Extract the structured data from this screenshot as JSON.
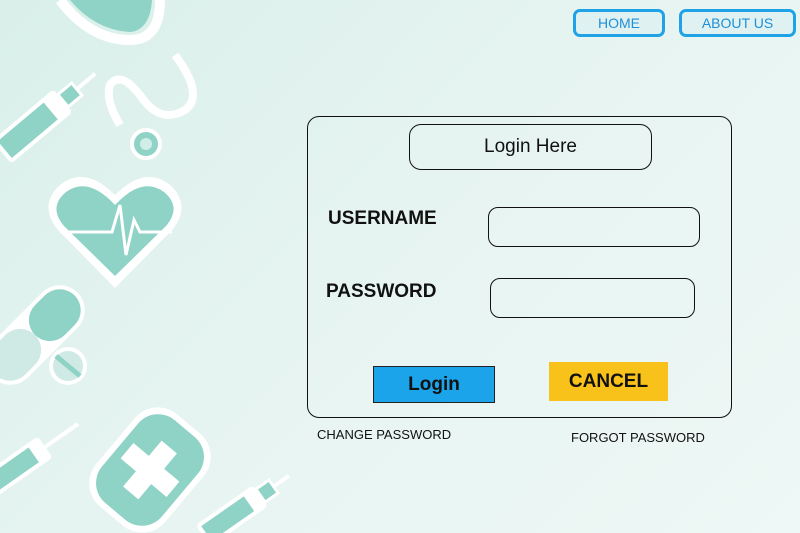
{
  "nav": {
    "home_label": "HOME",
    "about_label": "ABOUT US"
  },
  "login_form": {
    "title": "Login Here",
    "username_label": "USERNAME",
    "username_value": "",
    "password_label": "PASSWORD",
    "password_value": "",
    "login_button": "Login",
    "cancel_button": "CANCEL",
    "change_password_link": "CHANGE PASSWORD",
    "forgot_password_link": "FORGOT PASSWORD"
  },
  "background_icons": [
    "stethoscope-icon",
    "syringe-icon",
    "heartbeat-icon",
    "pill-capsule-icon",
    "pill-tablet-icon",
    "medicine-bottle-icon"
  ],
  "colors": {
    "background": "#e6f4f1",
    "icon_teal": "#8fd2c6",
    "nav_border": "#1fa3e6",
    "login_button": "#1ba4ea",
    "cancel_button": "#f8c21a"
  }
}
